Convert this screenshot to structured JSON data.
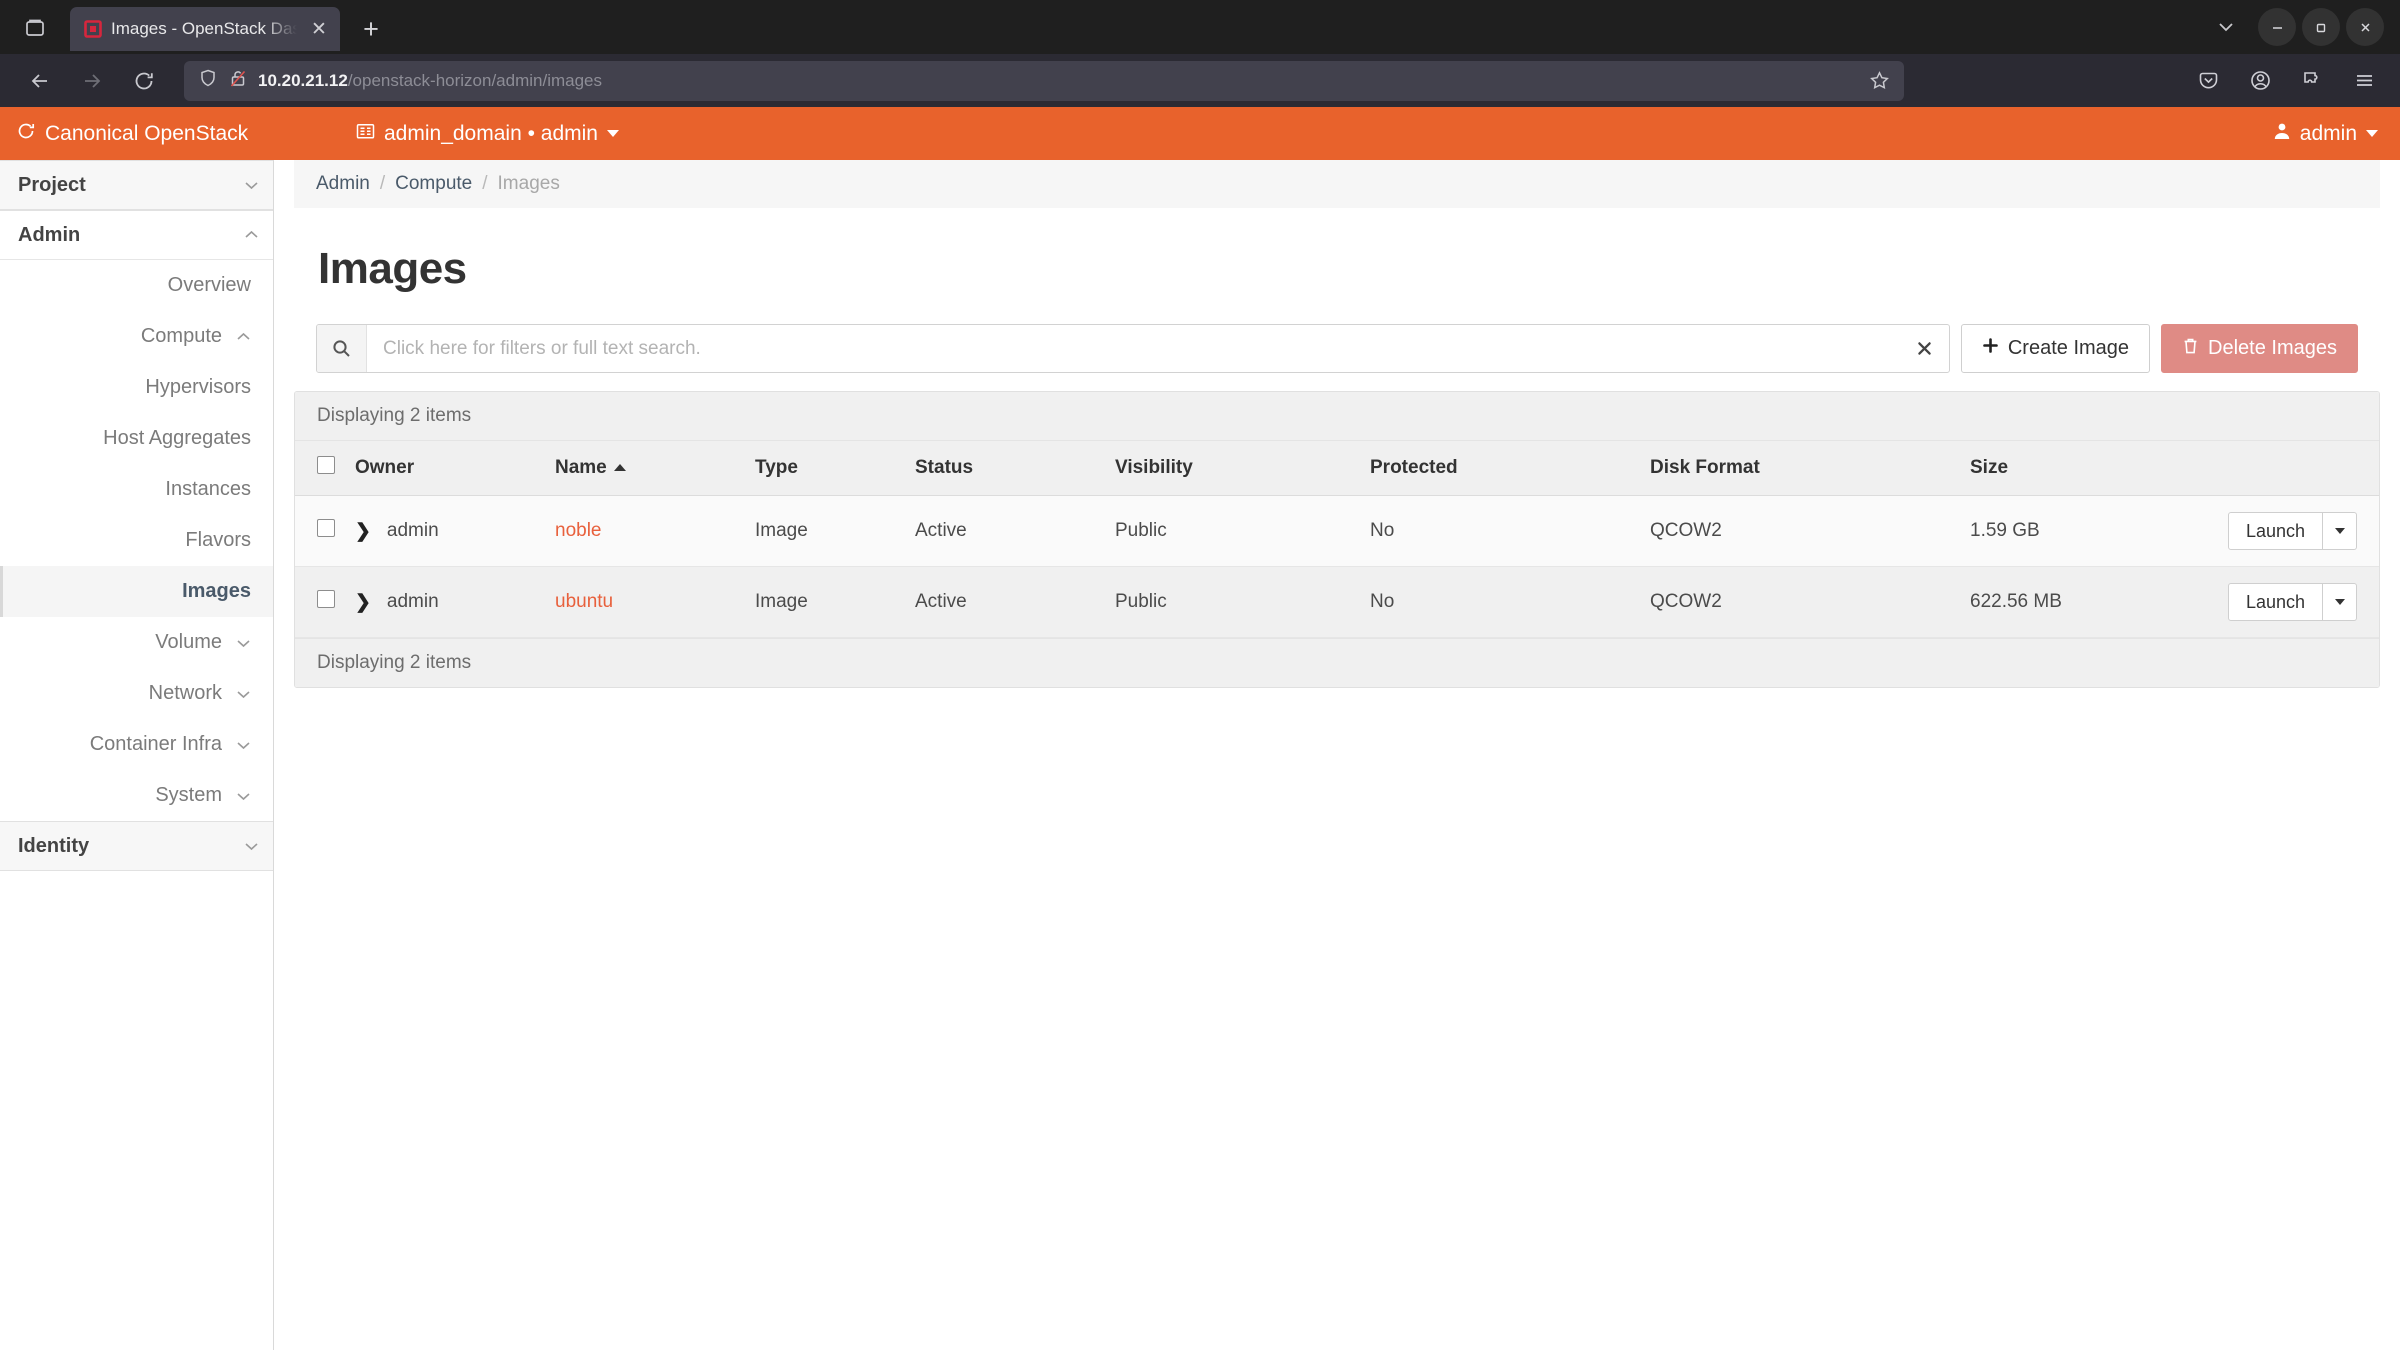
{
  "browser": {
    "tab": {
      "title": "Images - OpenStack Dash",
      "favicon_name": "openstack-favicon",
      "close_label": "✕"
    },
    "new_tab_label": "+",
    "window_controls": {
      "chevron": "chevron-down",
      "minimize": "—",
      "maximize": "❐",
      "close": "✕"
    },
    "nav": {
      "back": "←",
      "forward": "→",
      "reload": "⟳"
    },
    "url": {
      "host": "10.20.21.12",
      "path": "/openstack-horizon/admin/images",
      "shield_icon": "shield-icon",
      "lock_icon": "lock-broken-icon",
      "bookmark_icon": "star-icon"
    },
    "toolbar_icons": [
      "pocket-icon",
      "account-icon",
      "extensions-icon",
      "app-menu-icon"
    ]
  },
  "topbar": {
    "brand": "Canonical OpenStack",
    "brand_icon": "openstack-logo-icon",
    "context": "admin_domain • admin",
    "context_icon": "domain-icon",
    "user": "admin",
    "user_icon": "user-icon",
    "bg_color": "#e8622c"
  },
  "sidebar": {
    "groups": [
      {
        "label": "Project",
        "expanded": false,
        "state_icon": "chevron-down-icon",
        "items": []
      },
      {
        "label": "Admin",
        "expanded": true,
        "state_icon": "chevron-up-icon",
        "items": [
          {
            "label": "Overview",
            "type": "link",
            "active": false
          },
          {
            "label": "Compute",
            "type": "group",
            "expanded": true,
            "state_icon": "chevron-up-icon",
            "active": false
          },
          {
            "label": "Hypervisors",
            "type": "link",
            "active": false,
            "depth": 2
          },
          {
            "label": "Host Aggregates",
            "type": "link",
            "active": false,
            "depth": 2
          },
          {
            "label": "Instances",
            "type": "link",
            "active": false,
            "depth": 2
          },
          {
            "label": "Flavors",
            "type": "link",
            "active": false,
            "depth": 2
          },
          {
            "label": "Images",
            "type": "link",
            "active": true,
            "depth": 2
          },
          {
            "label": "Volume",
            "type": "group",
            "expanded": false,
            "state_icon": "chevron-down-icon",
            "active": false
          },
          {
            "label": "Network",
            "type": "group",
            "expanded": false,
            "state_icon": "chevron-down-icon",
            "active": false
          },
          {
            "label": "Container Infra",
            "type": "group",
            "expanded": false,
            "state_icon": "chevron-down-icon",
            "active": false
          },
          {
            "label": "System",
            "type": "group",
            "expanded": false,
            "state_icon": "chevron-down-icon",
            "active": false
          }
        ]
      },
      {
        "label": "Identity",
        "expanded": false,
        "state_icon": "chevron-down-icon",
        "items": []
      }
    ]
  },
  "main": {
    "breadcrumb": [
      {
        "label": "Admin",
        "current": false
      },
      {
        "label": "Compute",
        "current": false
      },
      {
        "label": "Images",
        "current": true
      }
    ],
    "breadcrumb_separator": "/",
    "page_title": "Images",
    "search": {
      "placeholder": "Click here for filters or full text search.",
      "value": "",
      "icon": "search-icon",
      "clear_icon": "clear-icon"
    },
    "buttons": {
      "create_image": {
        "label": "Create Image",
        "icon": "plus-icon"
      },
      "delete_images": {
        "label": "Delete Images",
        "icon": "trash-icon",
        "color": "#df8b85",
        "disabled": true
      }
    },
    "table": {
      "count_top": "Displaying 2 items",
      "count_bottom": "Displaying 2 items",
      "sort_column": "Name",
      "sort_direction": "asc",
      "columns": [
        "",
        "Owner",
        "Name",
        "Type",
        "Status",
        "Visibility",
        "Protected",
        "Disk Format",
        "Size",
        ""
      ],
      "rows": [
        {
          "owner": "admin",
          "name": "noble",
          "type": "Image",
          "status": "Active",
          "visibility": "Public",
          "protected": "No",
          "disk_format": "QCOW2",
          "size": "1.59 GB",
          "action": "Launch",
          "checked": false
        },
        {
          "owner": "admin",
          "name": "ubuntu",
          "type": "Image",
          "status": "Active",
          "visibility": "Public",
          "protected": "No",
          "disk_format": "QCOW2",
          "size": "622.56 MB",
          "action": "Launch",
          "checked": false
        }
      ]
    }
  }
}
